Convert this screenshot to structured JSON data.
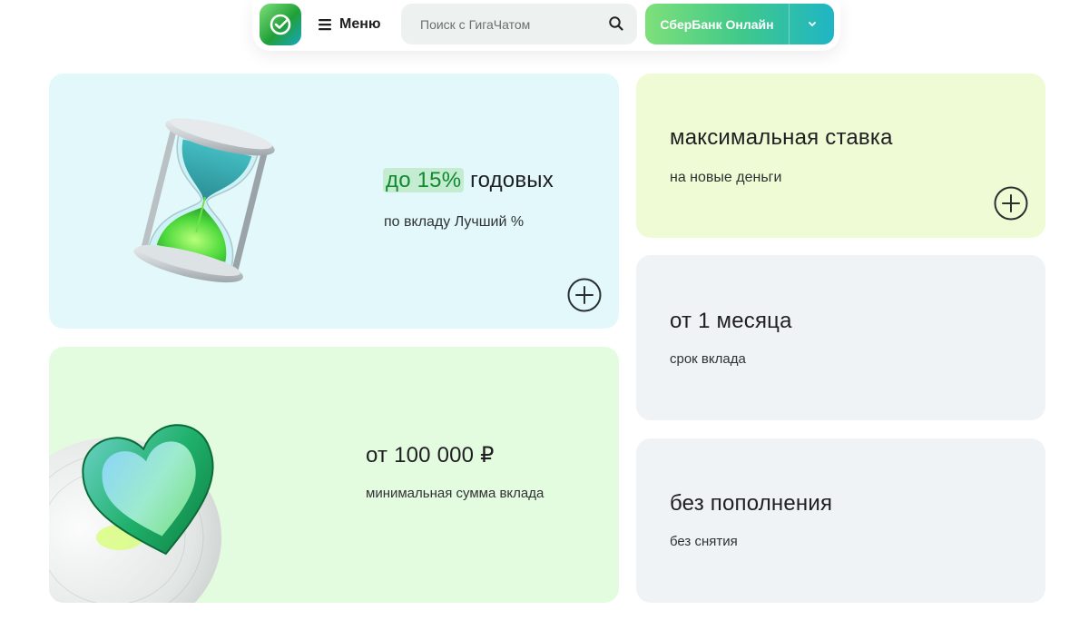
{
  "header": {
    "menu_label": "Меню",
    "search_placeholder": "Поиск с ГигаЧатом",
    "online_label": "СберБанк Онлайн"
  },
  "cards": {
    "rate": {
      "highlight": "до 15%",
      "title_rest": "годовых",
      "subtitle": "по вкладу Лучший %"
    },
    "sum": {
      "title": "от 100 000 ₽",
      "subtitle": "минимальная сумма вклада"
    },
    "max": {
      "title": "максимальная ставка",
      "subtitle": "на новые деньги"
    },
    "term": {
      "title": "от 1 месяца",
      "subtitle": "срок вклада"
    },
    "replenish": {
      "title": "без пополнения",
      "subtitle": "без снятия"
    }
  },
  "icons": {
    "logo": "sber-logo-icon",
    "menu": "hamburger-menu-icon",
    "search": "search-icon",
    "chevron": "chevron-down-icon",
    "plus": "plus-circle-icon",
    "hourglass": "hourglass-icon",
    "heart": "glass-heart-icon"
  },
  "colors": {
    "accent_green": "#21a038",
    "highlight_bg": "#c4ecd1",
    "card_rate": "#e2f8fa",
    "card_sum": "#e3fce0",
    "card_max": "#eefbd5",
    "card_neutral": "#f0f3f6"
  }
}
